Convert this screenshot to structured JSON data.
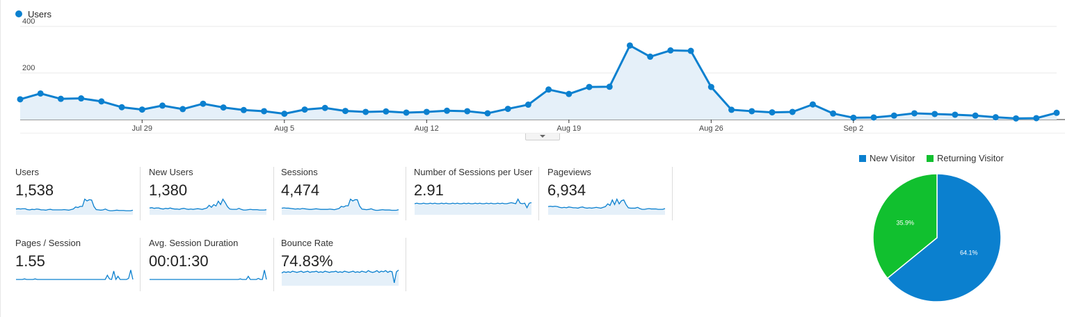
{
  "chart_data": [
    {
      "type": "area",
      "title": "",
      "series": [
        {
          "name": "Users",
          "color": "#0b80cf",
          "values": [
            87,
            112,
            89,
            91,
            78,
            53,
            43,
            60,
            45,
            68,
            52,
            41,
            36,
            25,
            43,
            50,
            37,
            33,
            35,
            30,
            33,
            38,
            36,
            27,
            46,
            64,
            129,
            110,
            140,
            141,
            318,
            270,
            297,
            295,
            140,
            42,
            36,
            31,
            33,
            65,
            26,
            8,
            9,
            17,
            27,
            24,
            21,
            17,
            10,
            5,
            6,
            29
          ]
        }
      ],
      "x_ticks": [
        {
          "index": 6,
          "label": "Jul 29"
        },
        {
          "index": 13,
          "label": "Aug 5"
        },
        {
          "index": 20,
          "label": "Aug 12"
        },
        {
          "index": 27,
          "label": "Aug 19"
        },
        {
          "index": 34,
          "label": "Aug 26"
        },
        {
          "index": 41,
          "label": "Sep 2"
        }
      ],
      "y_ticks": [
        200,
        400
      ],
      "ylim": [
        0,
        400
      ],
      "grid": true,
      "legend": "top-left"
    },
    {
      "type": "pie",
      "slices": [
        {
          "label": "New Visitor",
          "value": 64.1,
          "display": "64.1%",
          "color": "#0b80cf"
        },
        {
          "label": "Returning Visitor",
          "value": 35.9,
          "display": "35.9%",
          "color": "#11c02f"
        }
      ],
      "legend": "top"
    }
  ],
  "metrics": [
    {
      "label": "Users",
      "value": "1,538",
      "spark": [
        20,
        21,
        20,
        21,
        21,
        18,
        17,
        19,
        18,
        20,
        19,
        17,
        17,
        16,
        18,
        19,
        17,
        17,
        17,
        17,
        17,
        18,
        17,
        16,
        18,
        20,
        27,
        25,
        29,
        29,
        54,
        48,
        52,
        51,
        29,
        18,
        17,
        16,
        17,
        20,
        16,
        14,
        14,
        15,
        16,
        15,
        15,
        15,
        14,
        14,
        14,
        16
      ],
      "fill": true
    },
    {
      "label": "New Users",
      "value": "1,380",
      "spark": [
        20,
        21,
        19,
        20,
        20,
        18,
        17,
        19,
        18,
        20,
        18,
        17,
        17,
        16,
        18,
        19,
        17,
        16,
        17,
        16,
        17,
        18,
        17,
        16,
        18,
        20,
        28,
        22,
        30,
        26,
        40,
        30,
        46,
        36,
        24,
        17,
        16,
        16,
        16,
        19,
        16,
        14,
        14,
        15,
        16,
        15,
        15,
        15,
        14,
        14,
        14,
        15
      ],
      "fill": true
    },
    {
      "label": "Sessions",
      "value": "4,474",
      "spark": [
        22,
        23,
        22,
        22,
        21,
        20,
        19,
        20,
        19,
        21,
        20,
        19,
        18,
        18,
        19,
        20,
        19,
        18,
        18,
        18,
        18,
        19,
        18,
        17,
        19,
        21,
        28,
        26,
        30,
        30,
        52,
        46,
        50,
        50,
        29,
        19,
        18,
        17,
        18,
        20,
        17,
        15,
        15,
        16,
        17,
        16,
        16,
        16,
        15,
        15,
        15,
        17
      ],
      "fill": true
    },
    {
      "label": "Number of Sessions per User",
      "value": "2.91",
      "spark": [
        22,
        23,
        22,
        22,
        23,
        22,
        22,
        23,
        22,
        23,
        22,
        22,
        23,
        22,
        23,
        22,
        22,
        23,
        22,
        23,
        22,
        22,
        23,
        22,
        23,
        22,
        22,
        23,
        22,
        23,
        22,
        22,
        23,
        22,
        23,
        22,
        22,
        23,
        22,
        23,
        22,
        22,
        23,
        24,
        23,
        22,
        31,
        23,
        22,
        23,
        14,
        23,
        24
      ],
      "fill": true
    },
    {
      "label": "Pageviews",
      "value": "6,934",
      "spark": [
        21,
        22,
        21,
        22,
        21,
        19,
        18,
        19,
        18,
        20,
        19,
        18,
        18,
        17,
        19,
        20,
        18,
        17,
        18,
        17,
        18,
        19,
        18,
        17,
        19,
        21,
        28,
        24,
        38,
        26,
        40,
        28,
        36,
        38,
        26,
        18,
        17,
        17,
        17,
        19,
        16,
        14,
        14,
        15,
        16,
        15,
        15,
        15,
        14,
        14,
        14,
        16
      ],
      "fill": true
    },
    {
      "label": "Pages / Session",
      "value": "1.55",
      "spark": [
        12,
        12,
        12,
        12,
        13,
        12,
        12,
        12,
        12,
        13,
        12,
        12,
        12,
        12,
        12,
        12,
        12,
        12,
        12,
        12,
        12,
        12,
        12,
        12,
        12,
        12,
        12,
        12,
        12,
        12,
        12,
        12,
        12,
        12,
        12,
        12,
        12,
        12,
        12,
        12,
        12,
        12,
        12,
        20,
        13,
        12,
        28,
        12,
        18,
        12,
        12,
        12,
        12,
        14,
        30,
        12
      ],
      "fill": false
    },
    {
      "label": "Avg. Session Duration",
      "value": "00:01:30",
      "spark": [
        12,
        12,
        12,
        12,
        12,
        12,
        12,
        12,
        12,
        12,
        12,
        12,
        12,
        12,
        12,
        12,
        12,
        12,
        12,
        12,
        12,
        12,
        12,
        12,
        12,
        12,
        12,
        12,
        12,
        12,
        12,
        12,
        12,
        12,
        12,
        12,
        12,
        12,
        12,
        12,
        12,
        12,
        12,
        12,
        12,
        13,
        12,
        12,
        12,
        18,
        12,
        12,
        12,
        12,
        14,
        12,
        12,
        30,
        12
      ],
      "fill": false
    },
    {
      "label": "Bounce Rate",
      "value": "74.83%",
      "spark": [
        22,
        24,
        23,
        24,
        23,
        25,
        24,
        23,
        24,
        25,
        23,
        24,
        25,
        23,
        24,
        24,
        25,
        23,
        24,
        23,
        25,
        24,
        23,
        24,
        24,
        25,
        23,
        24,
        23,
        25,
        24,
        23,
        24,
        25,
        23,
        24,
        23,
        25,
        24,
        23,
        26,
        24,
        23,
        24,
        26,
        23,
        25,
        24,
        26,
        23,
        25,
        24,
        5,
        24,
        27
      ],
      "fill": true
    }
  ]
}
